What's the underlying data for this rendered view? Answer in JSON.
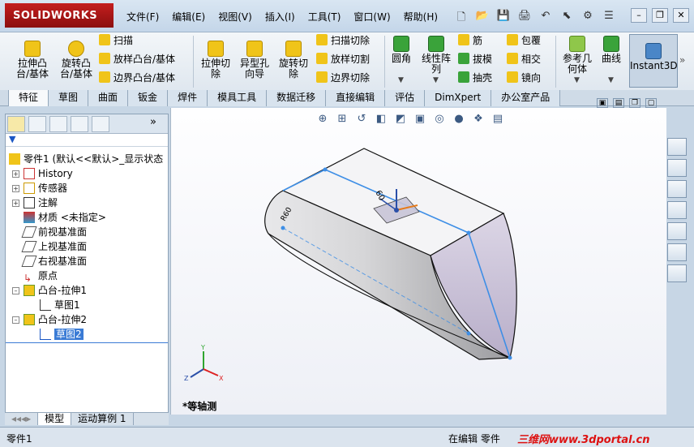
{
  "app": {
    "brand": "SOLIDWORKS"
  },
  "menu": [
    "文件(F)",
    "编辑(E)",
    "视图(V)",
    "插入(I)",
    "工具(T)",
    "窗口(W)",
    "帮助(H)"
  ],
  "ribbon": {
    "extrude_boss": "拉伸凸\n台/基体",
    "revolve_boss": "旋转凸\n台/基体",
    "sweep": "扫描",
    "loft_boss": "放样凸台/基体",
    "boundary_boss": "边界凸台/基体",
    "extrude_cut": "拉伸切\n除",
    "hole_wizard": "异型孔\n向导",
    "revolve_cut": "旋转切\n除",
    "sweep_cut": "扫描切除",
    "loft_cut": "放样切割",
    "boundary_cut": "边界切除",
    "fillet": "圆角",
    "linear_pattern": "线性阵\n列",
    "rib": "筋",
    "draft": "拔模",
    "shell": "抽壳",
    "wrap": "包覆",
    "intersect": "相交",
    "mirror": "镜向",
    "ref_geometry": "参考几\n何体",
    "curves": "曲线",
    "instant3d": "Instant3D"
  },
  "tabs": [
    "特征",
    "草图",
    "曲面",
    "钣金",
    "焊件",
    "模具工具",
    "数据迁移",
    "直接编辑",
    "评估",
    "DimXpert",
    "办公室产品"
  ],
  "tree": {
    "root": "零件1  (默认<<默认>_显示状态",
    "items": [
      "History",
      "传感器",
      "注解",
      "材质 <未指定>",
      "前视基准面",
      "上视基准面",
      "右视基准面",
      "原点",
      "凸台-拉伸1",
      "草图1",
      "凸台-拉伸2",
      "草图2"
    ]
  },
  "bottom_tabs": [
    "模型",
    "运动算例 1"
  ],
  "viewport": {
    "view_label": "*等轴测"
  },
  "status": {
    "left": "零件1",
    "middle": "在编辑 零件",
    "watermark": "三维网www.3dportal.cn"
  }
}
